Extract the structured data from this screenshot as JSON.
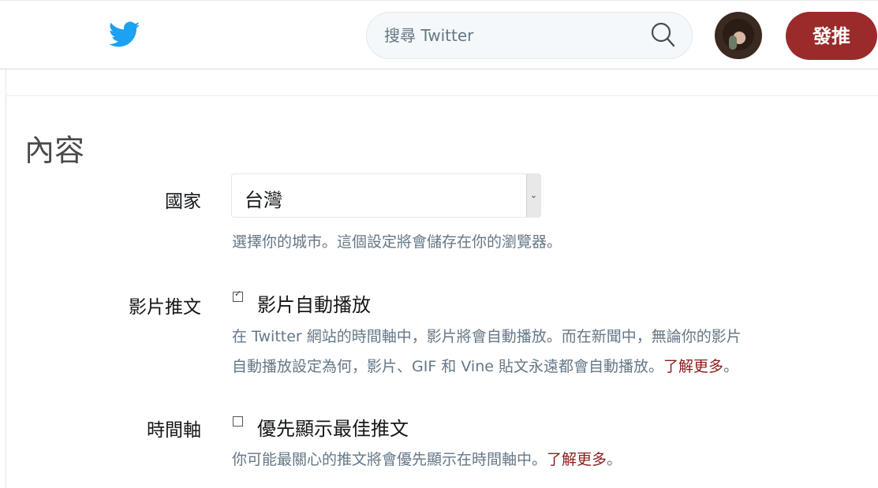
{
  "header": {
    "logo_icon": "twitter-bird-icon",
    "search_placeholder": "搜尋 Twitter",
    "search_icon": "search-icon",
    "tweet_button_label": "發推",
    "accent_color": "#9b2b2b",
    "logo_color": "#1da1f2"
  },
  "content": {
    "section_title": "內容",
    "country": {
      "label": "國家",
      "selected": "台灣",
      "help": "選擇你的城市。這個設定將會儲存在你的瀏覽器。"
    },
    "video": {
      "label": "影片推文",
      "checkbox_label": "影片自動播放",
      "checked": true,
      "help_line1": "在 Twitter 網站的時間軸中，影片將會自動播放。而在新聞中，無論你的影片",
      "help_line2": "自動播放設定為何，影片、GIF 和 Vine 貼文永遠都會自動播放。",
      "learn_more": "了解更多",
      "help_end": "。"
    },
    "timeline": {
      "label": "時間軸",
      "checkbox_label": "優先顯示最佳推文",
      "checked": false,
      "help": "你可能最關心的推文將會優先顯示在時間軸中。",
      "learn_more": "了解更多",
      "help_end": "。"
    }
  }
}
